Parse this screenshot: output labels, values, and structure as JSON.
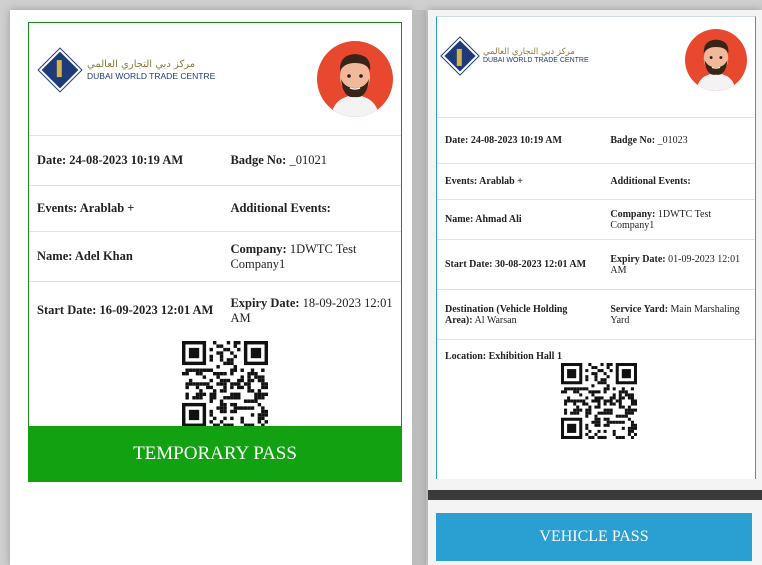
{
  "left": {
    "logo_ar": "مركز دبي التجاري العالمي",
    "logo_en": "DUBAI WORLD TRADE CENTRE",
    "rows": [
      [
        {
          "label": "Date: 24-08-2023 10:19 AM",
          "value": ""
        },
        {
          "label": "Badge No:",
          "value": " _01021"
        }
      ],
      [
        {
          "label": "Events: Arablab +",
          "value": ""
        },
        {
          "label": "Additional Events:",
          "value": ""
        }
      ],
      [
        {
          "label": "Name: Adel Khan",
          "value": ""
        },
        {
          "label": "Company:",
          "value": " 1DWTC Test Company1"
        }
      ],
      [
        {
          "label": "Start Date: 16-09-2023 12:01 AM",
          "value": ""
        },
        {
          "label": "Expiry Date:",
          "value": " 18-09-2023 12:01 AM"
        }
      ]
    ],
    "banner": "TEMPORARY PASS",
    "banner_color": "#11a111"
  },
  "right": {
    "logo_ar": "مركز دبي التجاري العالمي",
    "logo_en": "DUBAI WORLD TRADE CENTRE",
    "rows": [
      [
        {
          "label": "Date: 24-08-2023 10:19 AM",
          "value": ""
        },
        {
          "label": "Badge No:",
          "value": " _01023"
        }
      ],
      [
        {
          "label": "Events: Arablab +",
          "value": ""
        },
        {
          "label": "Additional Events:",
          "value": ""
        }
      ],
      [
        {
          "label": "Name: Ahmad Ali",
          "value": ""
        },
        {
          "label": "Company:",
          "value": " 1DWTC Test Company1"
        }
      ],
      [
        {
          "label": "Start Date: 30-08-2023 12:01 AM",
          "value": ""
        },
        {
          "label": "Expiry Date:",
          "value": " 01-09-2023 12:01 AM"
        }
      ],
      [
        {
          "label": "Destination (Vehicle Holding Area):",
          "value": " Al Warsan"
        },
        {
          "label": "Service Yard:",
          "value": " Main Marshaling Yard"
        }
      ],
      [
        {
          "label": "Location: Exhibition Hall 1",
          "value": ""
        },
        {
          "label": "",
          "value": ""
        }
      ]
    ],
    "banner": "VEHICLE PASS",
    "banner_color": "#2a9fd1"
  },
  "icons": {
    "avatar": "avatar-icon",
    "qr": "qr-code-icon",
    "logo": "dwtc-logo-icon"
  }
}
